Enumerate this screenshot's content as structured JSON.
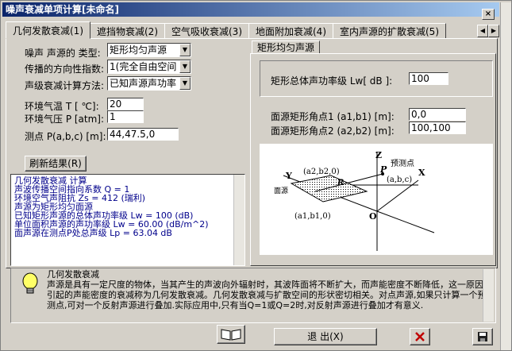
{
  "window": {
    "title": "噪声衰减单项计算[未命名]",
    "close_label": "×"
  },
  "tabs": [
    {
      "label": "几何发散衰减(1)"
    },
    {
      "label": "遮挡物衰减(2)"
    },
    {
      "label": "空气吸收衰减(3)"
    },
    {
      "label": "地面附加衰减(4)"
    },
    {
      "label": "室内声源的扩散衰减(5)"
    }
  ],
  "left": {
    "source_type_label": "噪声 声源的 类型:",
    "source_type_value": "矩形均匀声源",
    "directivity_label": "传播的方向性指数:",
    "directivity_value": "1(完全自由空间",
    "method_label": "声级衰减计算方法:",
    "method_value": "已知声源声功率",
    "temp_label": "环境气温 T [ ℃]:",
    "temp_value": "20",
    "pressure_label": "环境气压 P [atm]:",
    "pressure_value": "1",
    "point_label": "测点 P(a,b,c) [m]:",
    "point_value": "44,47.5,0",
    "refresh_button": "刷新结果(R)"
  },
  "results": {
    "lines": [
      "几何发散衰减 计算",
      "    声波传播空间指向系数 Q = 1",
      "    环境空气声阻抗        Zs = 412 (瑞利)",
      "    声源为矩形均匀面源",
      "    已知矩形声源的总体声功率级 Lw = 100 (dB)",
      "    单位面积声源的声功率级 Lw = 60.00 (dB/m^2)",
      "    面声源在测点P处总声级 Lp = 63.04 dB"
    ]
  },
  "right": {
    "subtab_label": "矩形均匀声源",
    "power_label": "矩形总体声功率级  Lw[ dB ]:",
    "power_value": "100",
    "corner1_label": "面源矩形角点1 (a1,b1) [m]:",
    "corner1_value": "0,0",
    "corner2_label": "面源矩形角点2 (a2,b2) [m]:",
    "corner2_value": "100,100"
  },
  "diagram": {
    "z_axis": "Z",
    "x_axis": "X",
    "y_axis": "Y",
    "origin": "O",
    "p_label": "P",
    "p_desc": "预测点",
    "abc_label": "(a,b,c)",
    "a2b2_label": "(a2,b2,0)",
    "a1b1_label": "(a1,b1,0)",
    "r_label": "R",
    "source_label": "面源"
  },
  "description": {
    "title": "几何发散衰减",
    "text": "声源是具有一定尺度的物体，当其产生的声波向外辐射时，其波阵面将不断扩大，而声能密度不断降低，这一原因引起的声能密度的衰减称为几何发散衰减。几何发散衰减与扩散空间的形状密切相关。对点声源,如果只计算一个预测点,可对一个反射声源进行叠加.实际应用中,只有当Q=1或Q=2时,对反射声源进行叠加才有意义."
  },
  "buttons": {
    "exit_label": "退 出(X)"
  }
}
